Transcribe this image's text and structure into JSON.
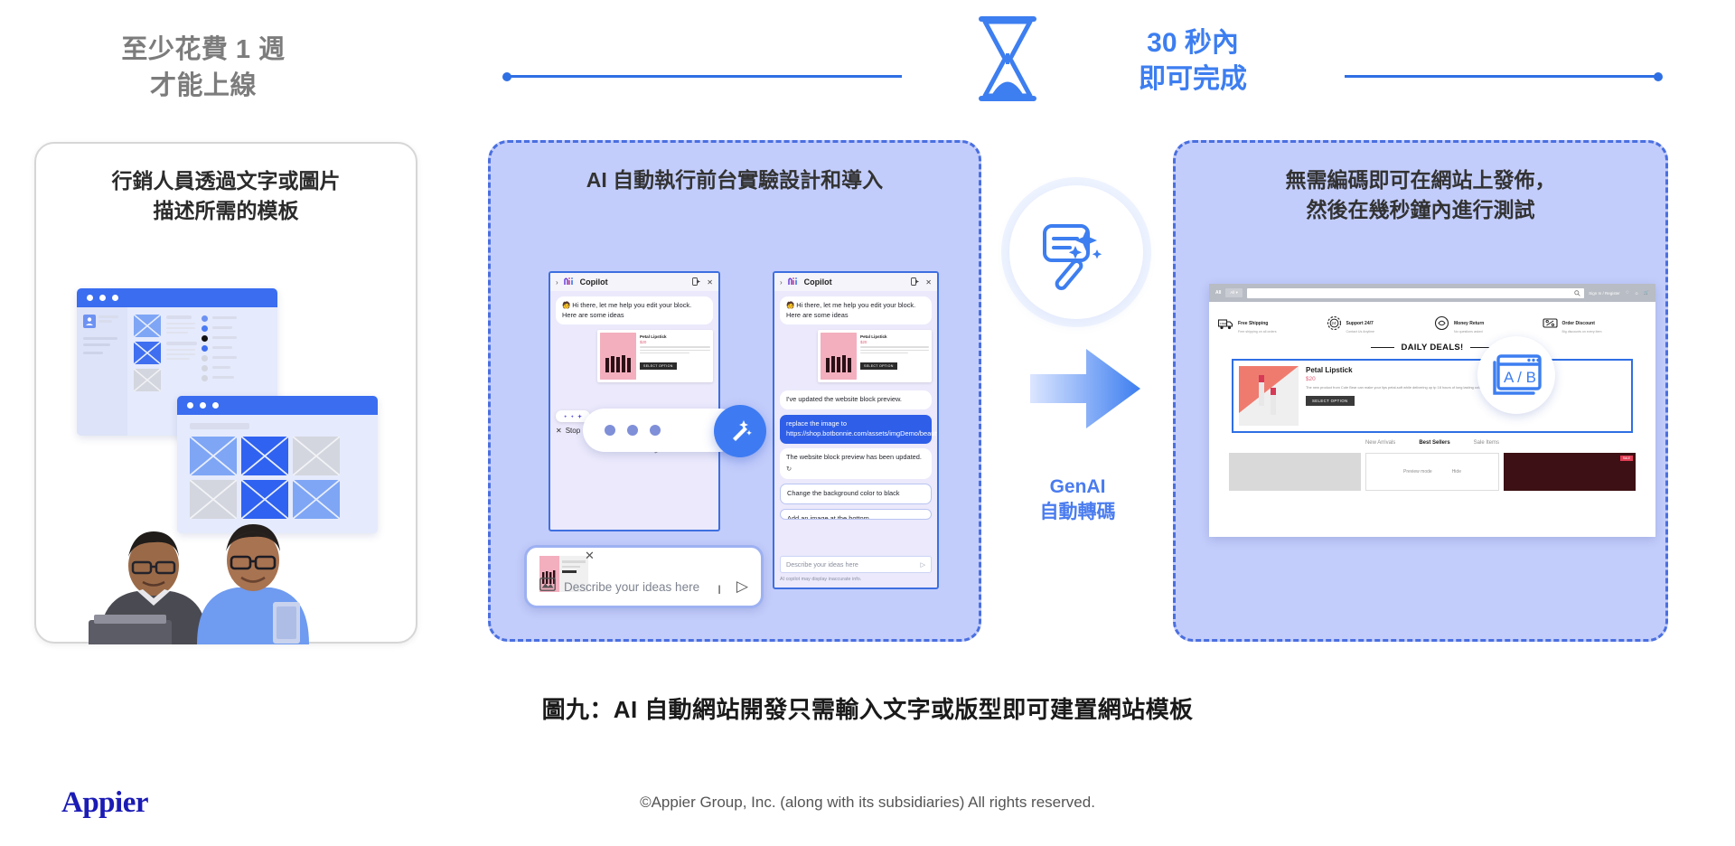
{
  "top": {
    "left_label_line1": "至少花費 1 週",
    "left_label_line2": "才能上線",
    "right_label_line1": "30 秒內",
    "right_label_line2": "即可完成",
    "hourglass_icon": "hourglass-icon"
  },
  "panels": {
    "left": {
      "title_line1": "行銷人員透過文字或圖片",
      "title_line2": "描述所需的模板"
    },
    "middle": {
      "title_line1": "AI 自動執行前台實驗設計和導入"
    },
    "right": {
      "title_line1": "無需編碼即可在網站上發佈，",
      "title_line2": "然後在幾秒鐘內進行測試"
    }
  },
  "copilot_left": {
    "app_name": "Copilot",
    "expand_icon": "chevron-right-icon",
    "brand_icon": "copilot-logo-icon",
    "panel_icon": "open-in-panel-icon",
    "close_icon": "close-icon",
    "assistant_message": "Hi there, let me help you edit your block. Here are some ideas",
    "assistant_emoji": "🧑",
    "product_card": {
      "name": "Petal Lipstick",
      "price": "$20",
      "button": "SELECT OPTION"
    },
    "stop_label": "Stop",
    "stop_icon": "close-icon",
    "sparkle_icon": "sparkles-icon"
  },
  "copilot_right": {
    "app_name": "Copilot",
    "expand_icon": "chevron-right-icon",
    "brand_icon": "copilot-logo-icon",
    "panel_icon": "open-in-panel-icon",
    "close_icon": "close-icon",
    "assistant_message": "Hi there, let me help you edit your block. Here are some ideas",
    "assistant_emoji": "🧑",
    "product_card": {
      "name": "Petal Lipstick",
      "price": "$20",
      "button": "SELECT OPTION"
    },
    "message_2": "I've updated the website block preview.",
    "user_message": "replace the image to https://shop.botbonnie.com/assets/imgDemo/beauty/PetalLipstick.png",
    "message_3": "The website block preview has been updated.",
    "refresh_icon": "refresh-icon",
    "suggestion_1": "Change the background color to black",
    "suggestion_2": "Add an image at the bottom",
    "input_placeholder": "Describe your ideas here",
    "send_icon": "send-icon",
    "disclaimer": "AI copilot may display inaccurate info."
  },
  "composer": {
    "placeholder": "Describe your ideas here",
    "image_icon": "image-icon",
    "send_icon": "send-icon",
    "close_icon": "close-icon",
    "text_cursor_icon": "text-cursor-icon"
  },
  "genai": {
    "wand_icon": "magic-wand-icon",
    "arrow_icon": "right-arrow-icon",
    "label_line1": "GenAI",
    "label_line2": "自動轉碼"
  },
  "shop": {
    "brand": "AII",
    "all_select": "All",
    "search_icon": "search-icon",
    "account_label": "Sign In / Register",
    "wishlist_icon": "heart-icon",
    "user_icon": "user-icon",
    "cart_icon": "cart-icon",
    "features": [
      {
        "icon": "truck-icon",
        "title": "Free Shipping",
        "subtitle": "Free shipping on all orders"
      },
      {
        "icon": "clock-icon",
        "title": "Support 24/7",
        "subtitle": "Contact Us Anytime"
      },
      {
        "icon": "refund-icon",
        "title": "Money Return",
        "subtitle": "No questions asked"
      },
      {
        "icon": "discount-icon",
        "title": "Order Discount",
        "subtitle": "Big discounts on every item"
      }
    ],
    "deals_heading": "DAILY DEALS!",
    "featured_product": {
      "name": "Petal Lipstick",
      "price": "$20",
      "description": "The new product from Cute Bear can make your lips petal-soft while delivering up tp 18 hours of long lasting color, keeping your lips soft and hydrated 24/7.",
      "button": "SELECT OPTION"
    },
    "nav_tabs": [
      {
        "label": "New Arrivals",
        "active": false
      },
      {
        "label": "Best Sellers",
        "active": true
      },
      {
        "label": "Sale Items",
        "active": false
      }
    ],
    "preview_mode": "Preview mode",
    "hide_label": "Hide",
    "sale_badge": "SALE",
    "ab_badge_text": "A / B",
    "ab_badge_icon": "ab-test-icon"
  },
  "caption": "圖九：AI 自動網站開發只需輸入文字或版型即可建置網站模板",
  "footer": {
    "logo": "Appier",
    "copyright": "©Appier Group, Inc. (along with its subsidiaries) All rights reserved."
  },
  "colors": {
    "brand_blue": "#2f6fe4",
    "panel_fill": "#c3cdfb",
    "accent_text": "#3d7ef0",
    "muted_gray": "#7c7c7c"
  }
}
